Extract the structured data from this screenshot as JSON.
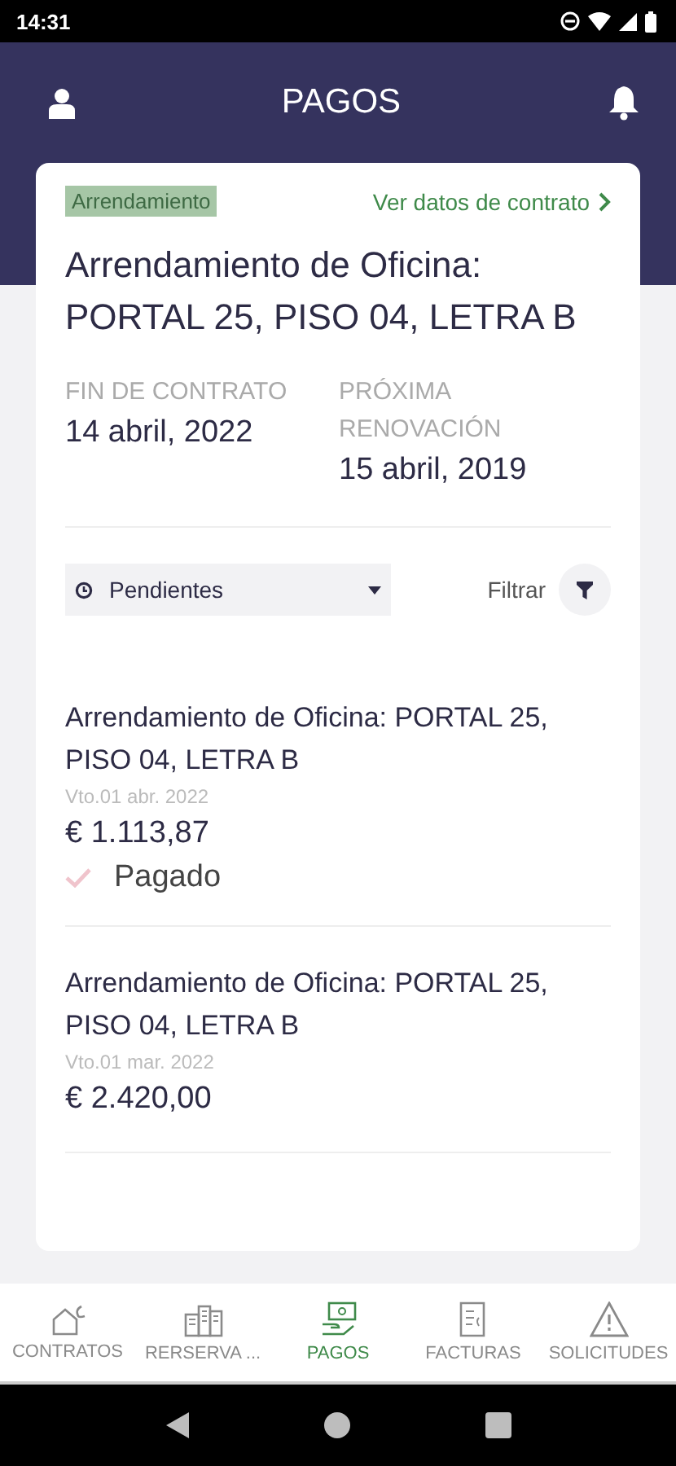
{
  "status_bar": {
    "time": "14:31"
  },
  "header": {
    "title": "PAGOS"
  },
  "contract": {
    "tag": "Arrendamiento",
    "link": "Ver datos de contrato",
    "title": "Arrendamiento de Oficina: PORTAL 25, PISO 04, LETRA B",
    "dates": [
      {
        "label": "FIN DE CONTRATO",
        "value": "14 abril, 2022"
      },
      {
        "label": "PRÓXIMA RENOVACIÓN",
        "value": "15 abril, 2019"
      }
    ]
  },
  "filter": {
    "dropdown": "Pendientes",
    "button": "Filtrar"
  },
  "payments": [
    {
      "title": "Arrendamiento de Oficina: PORTAL 25, PISO 04, LETRA B",
      "due": "Vto.01 abr. 2022",
      "amount": "€ 1.113,87",
      "status": "Pagado",
      "paid": true
    },
    {
      "title": "Arrendamiento de Oficina: PORTAL 25, PISO 04, LETRA B",
      "due": "Vto.01 mar. 2022",
      "amount": "€ 2.420,00"
    }
  ],
  "tabs": [
    {
      "label": "CONTRATOS",
      "kind": "house",
      "selected": false
    },
    {
      "label": "RERSERVA ...",
      "kind": "building",
      "selected": false
    },
    {
      "label": "PAGOS",
      "kind": "money",
      "selected": true
    },
    {
      "label": "FACTURAS",
      "kind": "invoice",
      "selected": false
    },
    {
      "label": "SOLICITUDES",
      "kind": "warning",
      "selected": false
    }
  ]
}
